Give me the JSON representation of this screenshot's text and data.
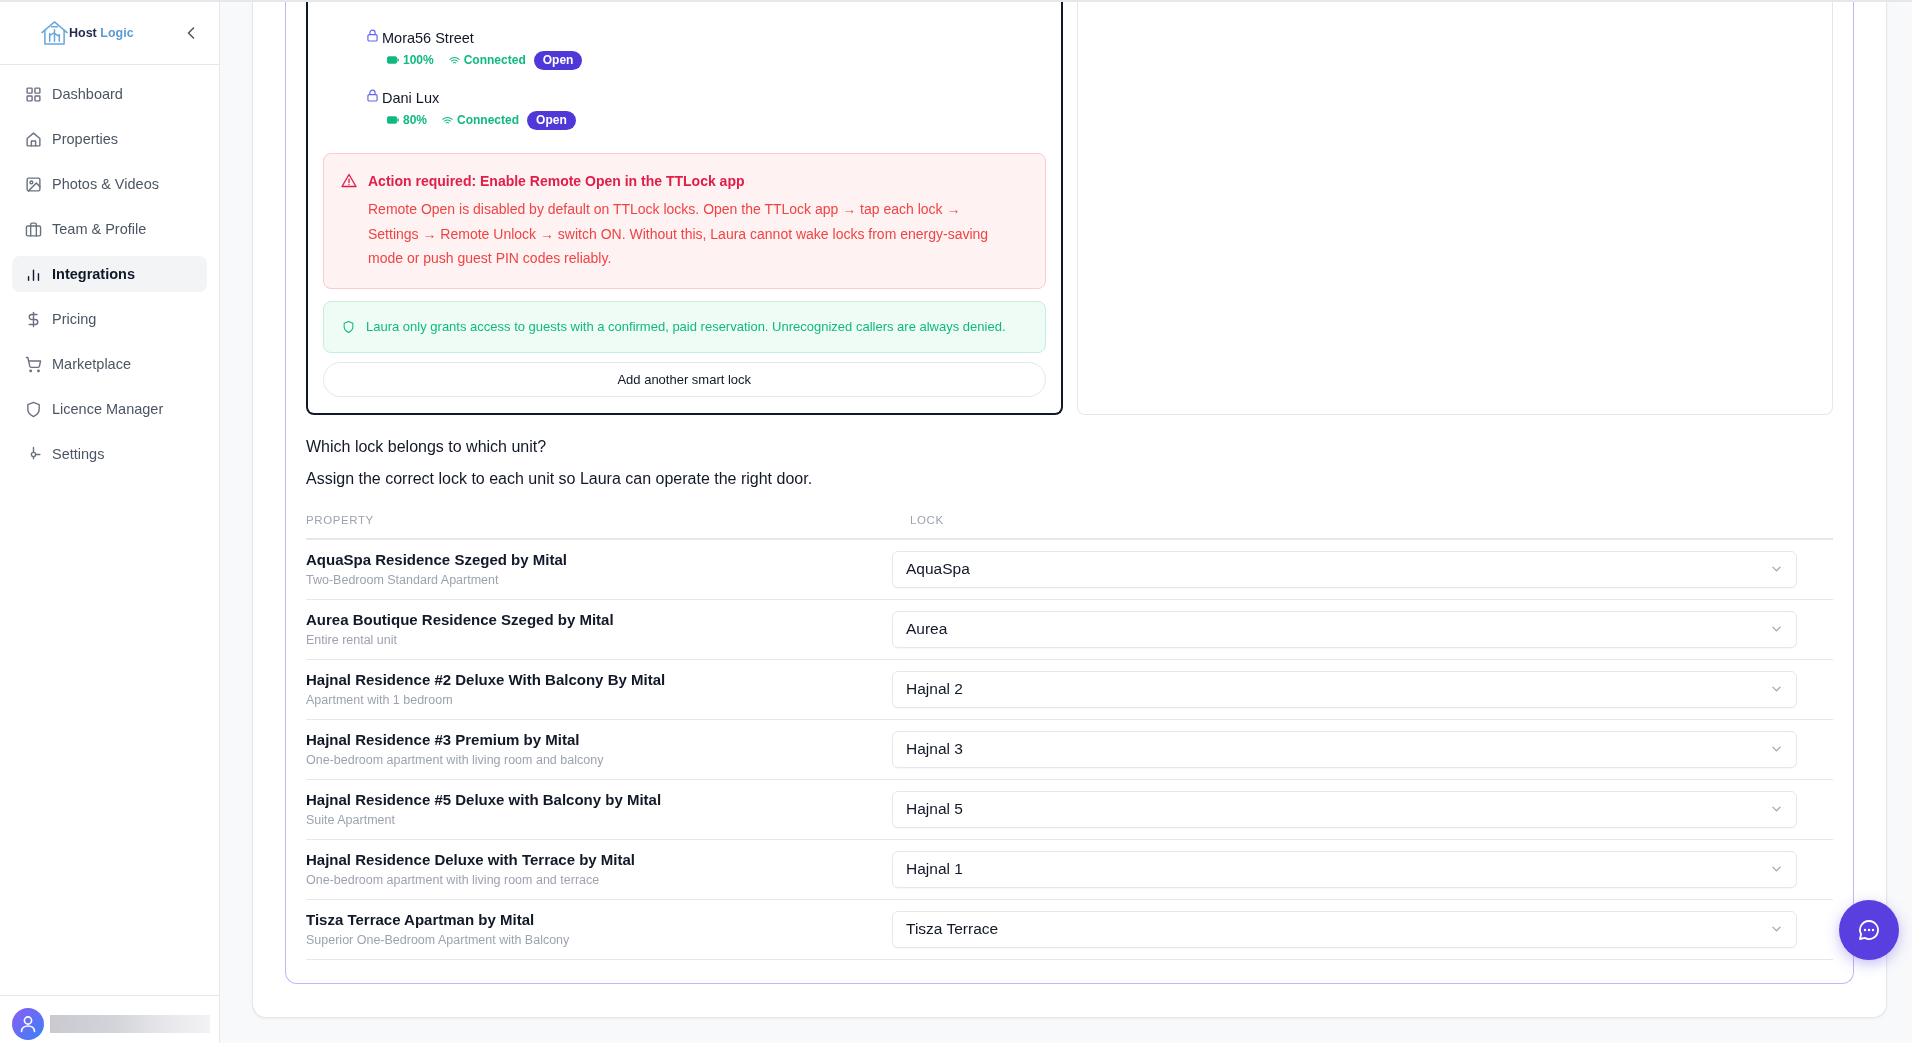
{
  "sidebar": {
    "brand": {
      "first": "Host",
      "second": "Logic"
    },
    "items": [
      {
        "label": "Dashboard",
        "selected": false
      },
      {
        "label": "Properties",
        "selected": false
      },
      {
        "label": "Photos & Videos",
        "selected": false
      },
      {
        "label": "Team & Profile",
        "selected": false
      },
      {
        "label": "Integrations",
        "selected": true
      },
      {
        "label": "Pricing",
        "selected": false
      },
      {
        "label": "Marketplace",
        "selected": false
      },
      {
        "label": "Licence Manager",
        "selected": false
      },
      {
        "label": "Settings",
        "selected": false
      }
    ]
  },
  "smart_locks": {
    "locks": [
      {
        "name": "Mora56 Street",
        "battery": "100%",
        "status": "Connected",
        "action": "Open"
      },
      {
        "name": "Dani Lux",
        "battery": "80%",
        "status": "Connected",
        "action": "Open"
      }
    ],
    "alert": {
      "title": "Action required: Enable Remote Open in the TTLock app",
      "body": "Remote Open is disabled by default on TTLock locks. Open the TTLock app → tap each lock → Settings → Remote Unlock → switch ON. Without this, Laura cannot wake locks from energy-saving mode or push guest PIN codes reliably."
    },
    "notice": "Laura only grants access to guests with a confirmed, paid reservation. Unrecognized callers are always denied.",
    "add_button": "Add another smart lock"
  },
  "lock_mapping": {
    "question": "Which lock belongs to which unit?",
    "instructions": "Assign the correct lock to each unit so Laura can operate the right door.",
    "columns": [
      "PROPERTY",
      "LOCK"
    ],
    "rows": [
      {
        "property": "AquaSpa Residence Szeged by Mital",
        "subtitle": "Two-Bedroom Standard Apartment",
        "lock": "AquaSpa"
      },
      {
        "property": "Aurea Boutique Residence Szeged by Mital",
        "subtitle": "Entire rental unit",
        "lock": "Aurea"
      },
      {
        "property": "Hajnal Residence #2 Deluxe With Balcony By Mital",
        "subtitle": "Apartment with 1 bedroom",
        "lock": "Hajnal 2"
      },
      {
        "property": "Hajnal Residence #3 Premium by Mital",
        "subtitle": "One-bedroom apartment with living room and balcony",
        "lock": "Hajnal 3"
      },
      {
        "property": "Hajnal Residence #5 Deluxe with Balcony by Mital",
        "subtitle": "Suite Apartment",
        "lock": "Hajnal 5"
      },
      {
        "property": "Hajnal Residence Deluxe with Terrace by Mital",
        "subtitle": "One-bedroom apartment with living room and terrace",
        "lock": "Hajnal 1"
      },
      {
        "property": "Tisza Terrace Apartman by Mital",
        "subtitle": "Superior One-Bedroom Apartment with Balcony",
        "lock": "Tisza Terrace"
      }
    ]
  }
}
